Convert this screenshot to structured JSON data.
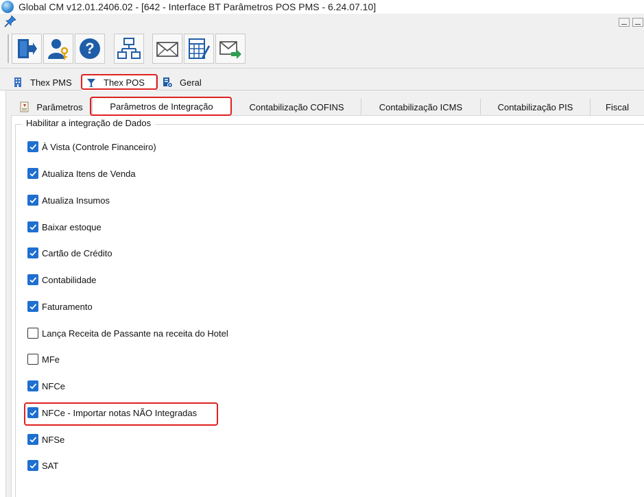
{
  "window": {
    "title": "Global CM v12.01.2406.02 - [642 - Interface BT Parâmetros POS PMS - 6.24.07.10]"
  },
  "toolbar": {
    "buttons": [
      {
        "icon": "exit-door-icon"
      },
      {
        "icon": "user-key-icon"
      },
      {
        "icon": "help-icon"
      },
      {
        "icon": "org-chart-icon"
      },
      {
        "icon": "envelope-icon"
      },
      {
        "icon": "calculator-sheet-icon"
      },
      {
        "icon": "send-mail-icon"
      }
    ]
  },
  "main_tabs": [
    {
      "label": "Thex PMS",
      "icon": "building-icon",
      "selected": false
    },
    {
      "label": "Thex POS",
      "icon": "cocktail-icon",
      "selected": true
    },
    {
      "label": "Geral",
      "icon": "settings-sheet-icon",
      "selected": false
    }
  ],
  "sub_tabs": [
    {
      "label": "Parâmetros",
      "icon": "parameters-icon",
      "selected": false
    },
    {
      "label": "Parâmetros de Integração",
      "selected": true
    },
    {
      "label": "Contabilização COFINS",
      "selected": false
    },
    {
      "label": "Contabilização ICMS",
      "selected": false
    },
    {
      "label": "Contabilização PIS",
      "selected": false
    },
    {
      "label": "Fiscal",
      "selected": false
    }
  ],
  "group": {
    "title": "Habilitar a integração de Dados",
    "options": [
      {
        "label": "À Vista (Controle Financeiro)",
        "checked": true
      },
      {
        "label": "Atualiza Itens de Venda",
        "checked": true
      },
      {
        "label": "Atualiza Insumos",
        "checked": true
      },
      {
        "label": "Baixar estoque",
        "checked": true
      },
      {
        "label": "Cartão de Crédito",
        "checked": true
      },
      {
        "label": "Contabilidade",
        "checked": true
      },
      {
        "label": "Faturamento",
        "checked": true
      },
      {
        "label": "Lança Receita de Passante na receita do Hotel",
        "checked": false
      },
      {
        "label": "MFe",
        "checked": false
      },
      {
        "label": "NFCe",
        "checked": true
      },
      {
        "label": "NFCe - Importar notas NÃO Integradas",
        "checked": true
      },
      {
        "label": "NFSe",
        "checked": true
      },
      {
        "label": "SAT",
        "checked": true
      }
    ]
  },
  "colors": {
    "highlight": "#e02020",
    "checkbox_checked": "#1e6fd0"
  }
}
